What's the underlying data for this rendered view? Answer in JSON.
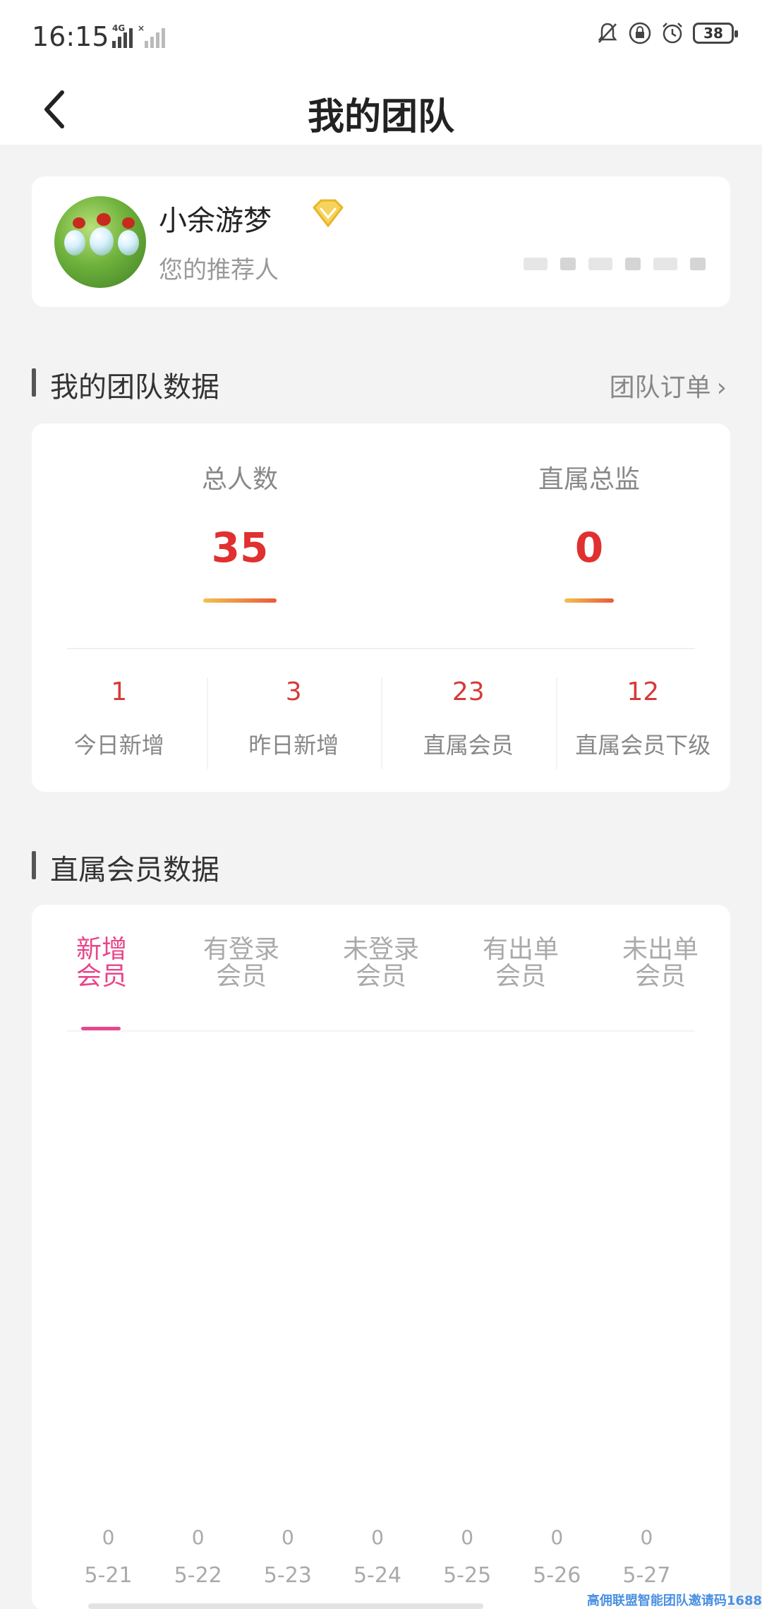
{
  "status_bar": {
    "time": "16:15",
    "network": "4G",
    "battery": "38"
  },
  "header": {
    "title": "我的团队"
  },
  "referrer": {
    "name": "小余游梦",
    "role": "您的推荐人"
  },
  "team_section": {
    "title": "我的团队数据",
    "orders_link": "团队订单",
    "total_label": "总人数",
    "total_value": "35",
    "supervisor_label": "直属总监",
    "supervisor_value": "0",
    "stats": [
      {
        "value": "1",
        "label": "今日新增"
      },
      {
        "value": "3",
        "label": "昨日新增"
      },
      {
        "value": "23",
        "label": "直属会员"
      },
      {
        "value": "12",
        "label": "直属会员下级"
      }
    ]
  },
  "member_section": {
    "title": "直属会员数据",
    "tabs": [
      {
        "line1": "新增",
        "line2": "会员"
      },
      {
        "line1": "有登录",
        "line2": "会员"
      },
      {
        "line1": "未登录",
        "line2": "会员"
      },
      {
        "line1": "有出单",
        "line2": "会员"
      },
      {
        "line1": "未出单",
        "line2": "会员"
      }
    ],
    "active_tab": 0,
    "chart": {
      "dates": [
        "5-21",
        "5-22",
        "5-23",
        "5-24",
        "5-25",
        "5-26",
        "5-27"
      ],
      "values": [
        "0",
        "0",
        "0",
        "0",
        "0",
        "0",
        "0"
      ]
    }
  },
  "watermark": "高佣联盟智能团队邀请码1688",
  "colors": {
    "accent_red": "#e03030",
    "tab_active": "#e8468a",
    "vip_diamond": "#f2c14e"
  },
  "icons": {
    "back": "chevron-left-icon",
    "vip": "diamond-icon",
    "orders_chevron": "chevron-right-icon"
  }
}
